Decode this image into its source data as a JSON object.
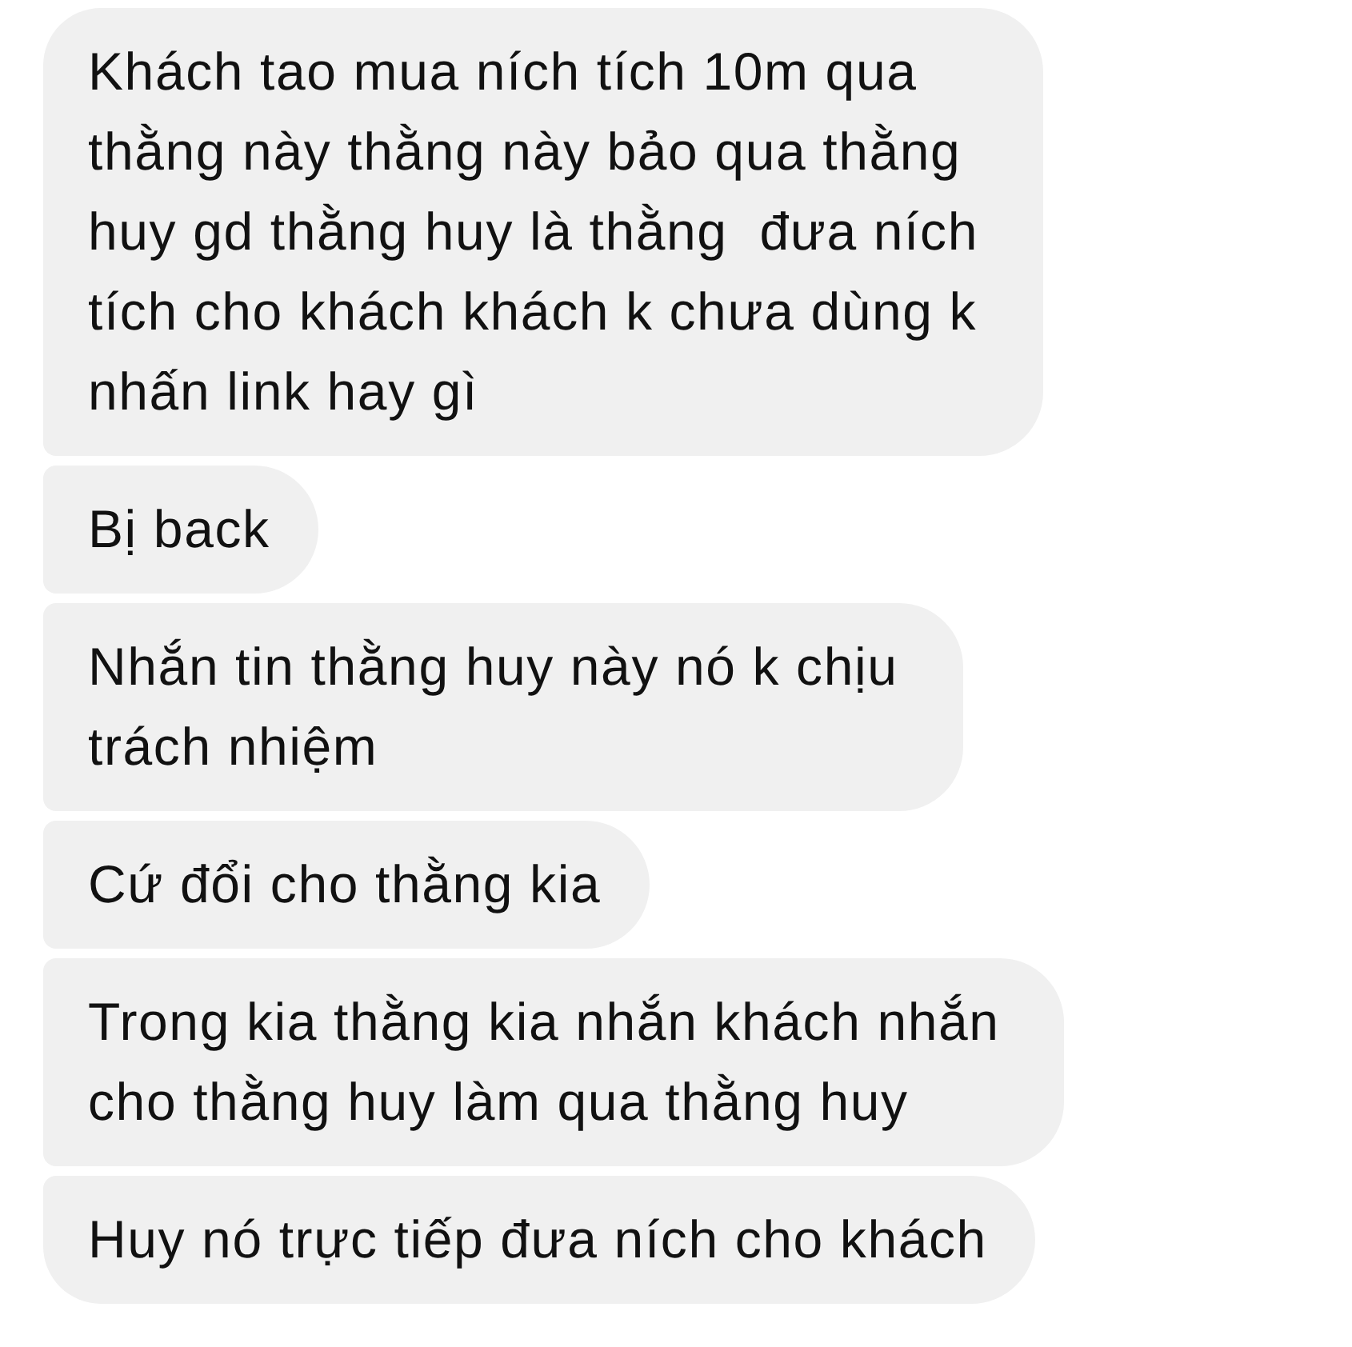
{
  "messages": [
    {
      "text": "Khách tao mua ních tích 10m qua thằng này thằng này bảo qua thằng huy gd thằng huy là thằng  đưa ních tích cho khách khách k chưa dùng k nhấn link hay gì"
    },
    {
      "text": "Bị back"
    },
    {
      "text": "Nhắn tin thằng huy này nó k chịu trách nhiệm"
    },
    {
      "text": "Cứ đổi cho thằng kia"
    },
    {
      "text": "Trong kia thằng kia nhắn khách nhắn cho thằng huy làm qua thằng huy"
    },
    {
      "text": "Huy nó trực tiếp đưa ních cho khách"
    }
  ]
}
